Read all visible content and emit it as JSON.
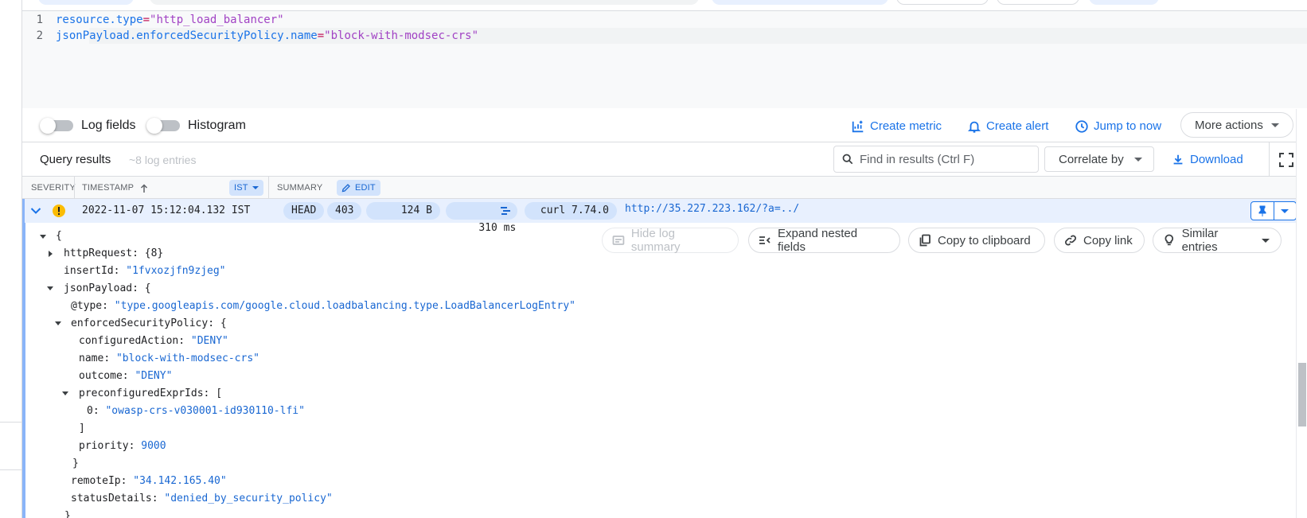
{
  "editor": {
    "lines": [
      {
        "num": "1",
        "key": "resource.type",
        "op": "=",
        "value": "\"http_load_balancer\""
      },
      {
        "num": "2",
        "key": "jsonPayload.enforcedSecurityPolicy.name",
        "op": "=",
        "value": "\"block-with-modsec-crs\""
      }
    ]
  },
  "toolbar": {
    "log_fields_label": "Log fields",
    "histogram_label": "Histogram",
    "create_metric_label": "Create metric",
    "create_alert_label": "Create alert",
    "jump_to_now_label": "Jump to now",
    "more_actions_label": "More actions"
  },
  "results": {
    "title": "Query results",
    "count": "~8 log entries",
    "find_placeholder": "Find in results (Ctrl F)",
    "correlate_label": "Correlate by",
    "download_label": "Download"
  },
  "columns": {
    "severity": "SEVERITY",
    "timestamp": "TIMESTAMP",
    "timezone": "IST",
    "summary": "SUMMARY",
    "edit": "EDIT"
  },
  "log_row": {
    "timestamp": "2022-11-07 15:12:04.132 IST",
    "method": "HEAD",
    "status": "403",
    "size": "124 B",
    "latency": "310 ms",
    "user_agent": "curl 7.74.0",
    "url": "http://35.227.223.162/?a=../"
  },
  "detail_actions": {
    "hide_summary": "Hide log summary",
    "expand_nested": "Expand nested fields",
    "copy_clipboard": "Copy to clipboard",
    "copy_link": "Copy link",
    "similar_entries": "Similar entries"
  },
  "json_tree": {
    "open_brace": "{",
    "http_request_key": "httpRequest",
    "http_request_val": "{8}",
    "insert_id_key": "insertId",
    "insert_id_val": "\"1fvxozjfn9zjeg\"",
    "json_payload_key": "jsonPayload",
    "at_type_key": "@type",
    "at_type_val": "\"type.googleapis.com/google.cloud.loadbalancing.type.LoadBalancerLogEntry\"",
    "esp_key": "enforcedSecurityPolicy",
    "configured_action_key": "configuredAction",
    "configured_action_val": "\"DENY\"",
    "name_key": "name",
    "name_val": "\"block-with-modsec-crs\"",
    "outcome_key": "outcome",
    "outcome_val": "\"DENY\"",
    "preconf_key": "preconfiguredExprIds",
    "preconf_0_key": "0",
    "preconf_0_val": "\"owasp-crs-v030001-id930110-lfi\"",
    "close_bracket": "]",
    "priority_key": "priority",
    "priority_val": "9000",
    "close_brace": "}",
    "remote_ip_key": "remoteIp",
    "remote_ip_val": "\"34.142.165.40\"",
    "status_details_key": "statusDetails",
    "status_details_val": "\"denied_by_security_policy\""
  },
  "colors": {
    "accent": "#1a73e8",
    "selected_row": "#e8f0fe",
    "badge": "#d2e3fc",
    "warning": "#fbbc04"
  }
}
